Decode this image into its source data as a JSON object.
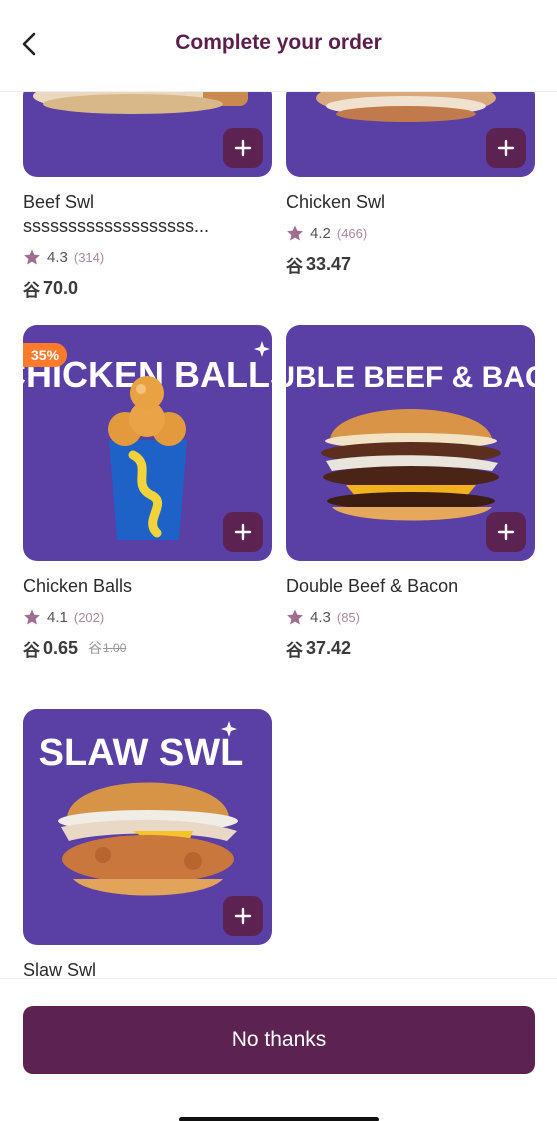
{
  "header": {
    "title": "Complete your order",
    "back_icon": "chevron-left-icon"
  },
  "currency_symbol": "⃁",
  "currency_display": "⾕",
  "products": [
    {
      "name": "Beef Swl",
      "name_line2": "sssssssssssssssssss...",
      "rating": "4.3",
      "reviews": "(314)",
      "price": "70.0"
    },
    {
      "name": "Chicken Swl",
      "rating": "4.2",
      "reviews": "(466)",
      "price": "33.47"
    },
    {
      "name": "Chicken Balls",
      "image_text": "CHICKEN BALLS",
      "badge": "35%",
      "rating": "4.1",
      "reviews": "(202)",
      "price": "0.65",
      "old_price": "1.00"
    },
    {
      "name": "Double Beef & Bacon",
      "image_text": "DOUBLE BEEF & BACON",
      "rating": "4.3",
      "reviews": "(85)",
      "price": "37.42"
    },
    {
      "name": "Slaw Swl",
      "image_text": "SLAW SWL"
    }
  ],
  "footer": {
    "no_thanks_label": "No thanks"
  },
  "colors": {
    "brand": "#5c2252",
    "tile": "#5a3fa5",
    "badge": "#ff7a2a",
    "star": "#9e6d8f"
  }
}
